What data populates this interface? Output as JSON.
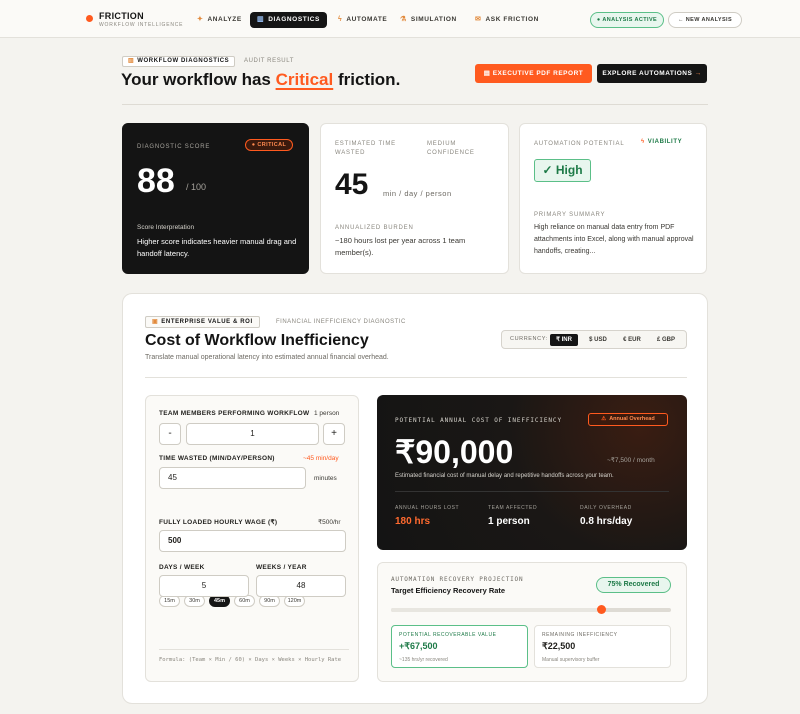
{
  "brand": {
    "title": "FRICTION",
    "subtitle": "WORKFLOW INTELLIGENCE"
  },
  "nav": {
    "links": [
      {
        "label": "ANALYZE",
        "icon": "bolt-icon",
        "active": false
      },
      {
        "label": "DIAGNOSTICS",
        "icon": "chart-icon",
        "active": true
      },
      {
        "label": "AUTOMATE",
        "icon": "lightning-icon",
        "active": false
      },
      {
        "label": "SIMULATION",
        "icon": "flask-icon",
        "active": false
      },
      {
        "label": "ASK FRICTION",
        "icon": "chat-icon",
        "active": false
      }
    ],
    "status": "ANALYSIS ACTIVE",
    "new_analysis": "NEW ANALYSIS"
  },
  "header": {
    "tag": "WORKFLOW DIAGNOSTICS",
    "tag_sub": "AUDIT RESULT",
    "headline_pre": "Your workflow has ",
    "headline_highlight": "Critical",
    "headline_post": " friction.",
    "pdf_button": "EXECUTIVE PDF REPORT",
    "explore_button": "EXPLORE AUTOMATIONS",
    "explore_arrow": "→"
  },
  "score_card": {
    "label": "DIAGNOSTIC SCORE",
    "badge": "CRITICAL",
    "score": "88",
    "of": "/ 100",
    "interp_title": "Score Interpretation",
    "interp_desc": "Higher score indicates heavier manual drag and handoff latency."
  },
  "time_card": {
    "label": "ESTIMATED TIME WASTED",
    "confidence": "MEDIUM CONFIDENCE",
    "value": "45",
    "unit": "min / day / person",
    "burden_label": "ANNUALIZED BURDEN",
    "burden_desc": "~180 hours lost per year across 1 team member(s)."
  },
  "automation_card": {
    "label": "AUTOMATION POTENTIAL",
    "viability": "VIABILITY",
    "value": "✓ High",
    "summary_label": "PRIMARY SUMMARY",
    "summary": "High reliance on manual data entry from PDF attachments into Excel, along with manual approval handoffs, creating..."
  },
  "cost": {
    "tag": "ENTERPRISE VALUE & ROI",
    "tag_sub": "FINANCIAL INEFFICIENCY DIAGNOSTIC",
    "title": "Cost of Workflow Inefficiency",
    "subtitle": "Translate manual operational latency into estimated annual financial overhead.",
    "currency_label": "CURRENCY:",
    "currencies": [
      "₹ INR",
      "$ USD",
      "€ EUR",
      "£ GBP"
    ],
    "currency_selected": 0
  },
  "form": {
    "team_label": "TEAM MEMBERS PERFORMING WORKFLOW",
    "team_value_label": "1 person",
    "team_value": "1",
    "minus": "-",
    "plus": "+",
    "time_label": "TIME WASTED (MIN/DAY/PERSON)",
    "time_delta": "~45 min/day",
    "time_value": "45",
    "time_unit": "minutes",
    "chips": [
      "15m",
      "30m",
      "45m",
      "60m",
      "90m",
      "120m"
    ],
    "chip_selected": 2,
    "wage_label": "FULLY LOADED HOURLY WAGE (₹)",
    "wage_rate": "₹500/hr",
    "wage_value": "500",
    "days_label": "DAYS / WEEK",
    "days_value": "5",
    "weeks_label": "WEEKS / YEAR",
    "weeks_value": "48",
    "formula": "Formula: (Team × Min / 60) × Days × Weeks × Hourly Rate"
  },
  "annual": {
    "label": "POTENTIAL ANNUAL COST OF INEFFICIENCY",
    "badge": "Annual Overhead",
    "value": "₹90,000",
    "monthly": "~₹7,500 / month",
    "desc": "Estimated financial cost of manual delay and repetitive handoffs across your team.",
    "stats": [
      {
        "label": "ANNUAL HOURS LOST",
        "value": "180 hrs"
      },
      {
        "label": "TEAM AFFECTED",
        "value": "1 person"
      },
      {
        "label": "DAILY OVERHEAD",
        "value": "0.8 hrs/day"
      }
    ]
  },
  "recovery": {
    "label": "AUTOMATION RECOVERY PROJECTION",
    "title": "Target Efficiency Recovery Rate",
    "badge": "75% Recovered",
    "rate": 0.75,
    "recoverable_label": "POTENTIAL RECOVERABLE VALUE",
    "recoverable_value": "+₹67,500",
    "recoverable_sub": "~135 hrs/yr recovered",
    "remaining_label": "REMAINING INEFFICIENCY",
    "remaining_value": "₹22,500",
    "remaining_sub": "Manual supervisory buffer"
  },
  "colors": {
    "accent": "#ff5a1f",
    "success": "#1d7a47",
    "dark": "#141414"
  }
}
